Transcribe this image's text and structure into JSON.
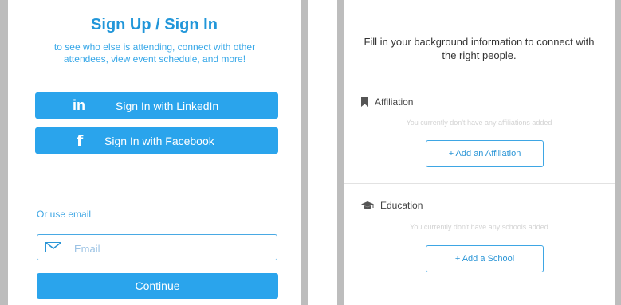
{
  "left": {
    "title": "Sign Up / Sign In",
    "subtitle": "to see who else is attending, connect with other attendees, view event schedule, and more!",
    "linkedin_icon": "in",
    "linkedin_label": "Sign In with LinkedIn",
    "facebook_icon": "f",
    "facebook_label": "Sign In with Facebook",
    "or_email": "Or use email",
    "email": {
      "placeholder": "Email",
      "value": ""
    },
    "continue_label": "Continue"
  },
  "right": {
    "intro": "Fill in your background information to connect with the right people.",
    "affiliation": {
      "icon": "bookmark-icon",
      "heading": "Affiliation",
      "empty_text": "You currently don't have any affiliations added",
      "add_label": "+ Add an Affiliation"
    },
    "education": {
      "icon": "graduation-cap-icon",
      "heading": "Education",
      "empty_text": "You currently don't have any schools added",
      "add_label": "+ Add a School"
    }
  },
  "colors": {
    "accent": "#2aa4ec",
    "title": "#2196d9",
    "border": "#3ea6e4",
    "gutter": "#bdbdbd"
  }
}
